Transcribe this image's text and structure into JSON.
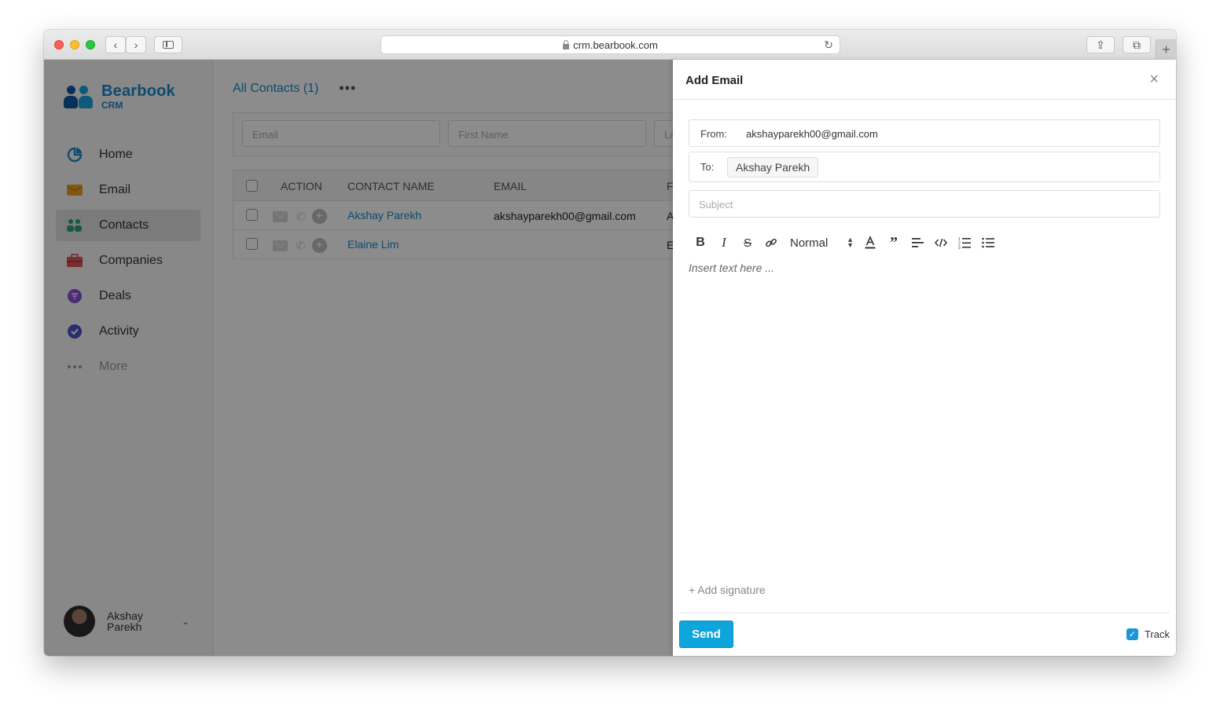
{
  "browser": {
    "url": "crm.bearbook.com"
  },
  "brand": {
    "name": "Bearbook",
    "sub": "CRM",
    "color": "#1b87c9"
  },
  "sidebar": {
    "items": [
      {
        "label": "Home",
        "icon": "pie-chart-icon",
        "color": "#1b87c9"
      },
      {
        "label": "Email",
        "icon": "envelope-icon",
        "color": "#e8a020"
      },
      {
        "label": "Contacts",
        "icon": "contacts-icon",
        "color": "#25a37d",
        "active": true
      },
      {
        "label": "Companies",
        "icon": "briefcase-icon",
        "color": "#e05555"
      },
      {
        "label": "Deals",
        "icon": "funnel-icon",
        "color": "#8a4fd6"
      },
      {
        "label": "Activity",
        "icon": "check-circle-icon",
        "color": "#4a55c8"
      },
      {
        "label": "More",
        "icon": "ellipsis-icon",
        "color": "#999999"
      }
    ],
    "user": {
      "name": "Akshay Parekh"
    }
  },
  "main": {
    "title": "All Contacts (1)",
    "filters": {
      "email_placeholder": "Email",
      "first_name_placeholder": "First Name",
      "last_name_placeholder": "La"
    },
    "table": {
      "headers": {
        "action": "ACTION",
        "contact_name": "CONTACT NAME",
        "email": "EMAIL",
        "extra": "F"
      },
      "rows": [
        {
          "name": "Akshay Parekh",
          "email": "akshayparekh00@gmail.com",
          "extra": "A"
        },
        {
          "name": "Elaine Lim",
          "email": "",
          "extra": "E"
        }
      ]
    }
  },
  "drawer": {
    "title": "Add Email",
    "from_label": "From:",
    "from_value": "akshayparekh00@gmail.com",
    "to_label": "To:",
    "to_chip": "Akshay Parekh",
    "subject_placeholder": "Subject",
    "toolbar": {
      "bold": "B",
      "italic": "I",
      "strike": "S",
      "size": "Normal"
    },
    "editor_placeholder": "Insert text here ...",
    "add_signature": "+ Add signature",
    "send_label": "Send",
    "track_label": "Track",
    "track_checked": true,
    "accent": "#0ea5dd"
  }
}
